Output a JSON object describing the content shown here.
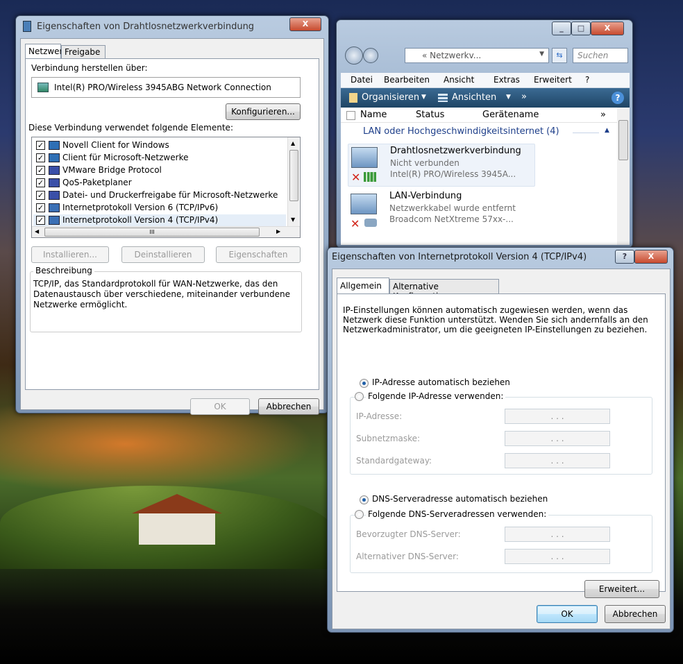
{
  "win1": {
    "title": "Eigenschaften von Drahtlosnetzwerkverbindung",
    "tabs": [
      "Netzwerk",
      "Freigabe"
    ],
    "connect_label": "Verbindung herstellen über:",
    "adapter": "Intel(R) PRO/Wireless 3945ABG Network Connection",
    "configure_btn": "Konfigurieren...",
    "elements_label": "Diese Verbindung verwendet folgende Elemente:",
    "items": [
      {
        "label": "Novell Client for Windows",
        "checked": true
      },
      {
        "label": "Client für Microsoft-Netzwerke",
        "checked": true
      },
      {
        "label": "VMware Bridge Protocol",
        "checked": true
      },
      {
        "label": "QoS-Paketplaner",
        "checked": true
      },
      {
        "label": "Datei- und Druckerfreigabe für Microsoft-Netzwerke",
        "checked": true
      },
      {
        "label": "Internetprotokoll Version 6 (TCP/IPv6)",
        "checked": true
      },
      {
        "label": "Internetprotokoll Version 4 (TCP/IPv4)",
        "checked": true
      }
    ],
    "install_btn": "Installieren...",
    "uninstall_btn": "Deinstallieren",
    "properties_btn": "Eigenschaften",
    "desc_legend": "Beschreibung",
    "desc_text": "TCP/IP, das Standardprotokoll für WAN-Netzwerke, das den Datenaustausch über verschiedene, miteinander verbundene Netzwerke ermöglicht.",
    "ok_btn": "OK",
    "cancel_btn": "Abbrechen"
  },
  "explorer": {
    "address": "« Netzwerkv...",
    "search_placeholder": "Suchen",
    "menu": [
      "Datei",
      "Bearbeiten",
      "Ansicht",
      "Extras",
      "Erweitert",
      "?"
    ],
    "organize": "Organisieren",
    "views": "Ansichten",
    "more": "»",
    "columns": [
      "Name",
      "Status",
      "Gerätename"
    ],
    "col_more": "»",
    "group_title": "LAN oder Hochgeschwindigkeitsinternet (4)",
    "connections": [
      {
        "name": "Drahtlosnetzwerkverbindung",
        "status": "Nicht verbunden",
        "device": "Intel(R) PRO/Wireless 3945A..."
      },
      {
        "name": "LAN-Verbindung",
        "status": "Netzwerkkabel wurde entfernt",
        "device": "Broadcom NetXtreme 57xx-..."
      }
    ]
  },
  "win2": {
    "title": "Eigenschaften von Internetprotokoll Version 4 (TCP/IPv4)",
    "help_btn": "?",
    "tabs": [
      "Allgemein",
      "Alternative Konfiguration"
    ],
    "intro": "IP-Einstellungen können automatisch zugewiesen werden, wenn das Netzwerk diese Funktion unterstützt. Wenden Sie sich andernfalls an den Netzwerkadministrator, um die geeigneten IP-Einstellungen zu beziehen.",
    "radio_auto_ip": "IP-Adresse automatisch beziehen",
    "radio_manual_ip": "Folgende IP-Adresse verwenden:",
    "ip_label": "IP-Adresse:",
    "subnet_label": "Subnetzmaske:",
    "gateway_label": "Standardgateway:",
    "radio_auto_dns": "DNS-Serveradresse automatisch beziehen",
    "radio_manual_dns": "Folgende DNS-Serveradressen verwenden:",
    "dns_pref_label": "Bevorzugter DNS-Server:",
    "dns_alt_label": "Alternativer DNS-Server:",
    "ip_placeholder": ".     .     .",
    "advanced_btn": "Erweitert...",
    "ok_btn": "OK",
    "cancel_btn": "Abbrechen"
  }
}
